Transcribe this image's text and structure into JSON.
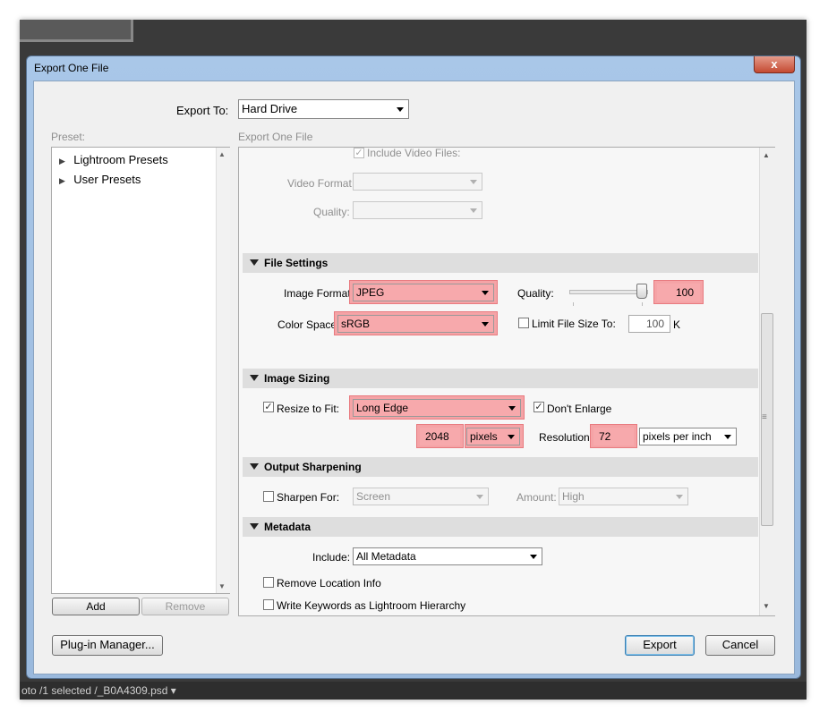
{
  "window": {
    "title": "Export One File",
    "close_label": "x"
  },
  "export_to": {
    "label": "Export To:",
    "value": "Hard Drive"
  },
  "preset": {
    "label": "Preset:",
    "items": [
      {
        "label": "Lightroom Presets"
      },
      {
        "label": "User Presets"
      }
    ],
    "add_label": "Add",
    "remove_label": "Remove"
  },
  "panel": {
    "title": "Export One File"
  },
  "video": {
    "include_label": "Include Video Files:",
    "format_label": "Video Format:",
    "quality_label": "Quality:"
  },
  "file_settings": {
    "header": "File Settings",
    "image_format_label": "Image Format:",
    "image_format_value": "JPEG",
    "quality_label": "Quality:",
    "quality_value": "100",
    "color_space_label": "Color Space:",
    "color_space_value": "sRGB",
    "limit_label": "Limit File Size To:",
    "limit_value": "100",
    "limit_unit": "K"
  },
  "image_sizing": {
    "header": "Image Sizing",
    "resize_label": "Resize to Fit:",
    "resize_value": "Long Edge",
    "dont_enlarge_label": "Don't Enlarge",
    "size_value": "2048",
    "size_unit": "pixels",
    "resolution_label": "Resolution:",
    "resolution_value": "72",
    "resolution_unit": "pixels per inch"
  },
  "output_sharpening": {
    "header": "Output Sharpening",
    "sharpen_label": "Sharpen For:",
    "sharpen_value": "Screen",
    "amount_label": "Amount:",
    "amount_value": "High"
  },
  "metadata": {
    "header": "Metadata",
    "include_label": "Include:",
    "include_value": "All Metadata",
    "remove_location_label": "Remove Location Info",
    "write_keywords_label": "Write Keywords as Lightroom Hierarchy"
  },
  "buttons": {
    "plugin_manager": "Plug-in Manager...",
    "export": "Export",
    "cancel": "Cancel"
  },
  "statusbar": {
    "text": "oto /1 selected /_B0A4309.psd ▾"
  },
  "colors": {
    "highlight": "#f5a3a6",
    "section_bg": "#dedede"
  }
}
